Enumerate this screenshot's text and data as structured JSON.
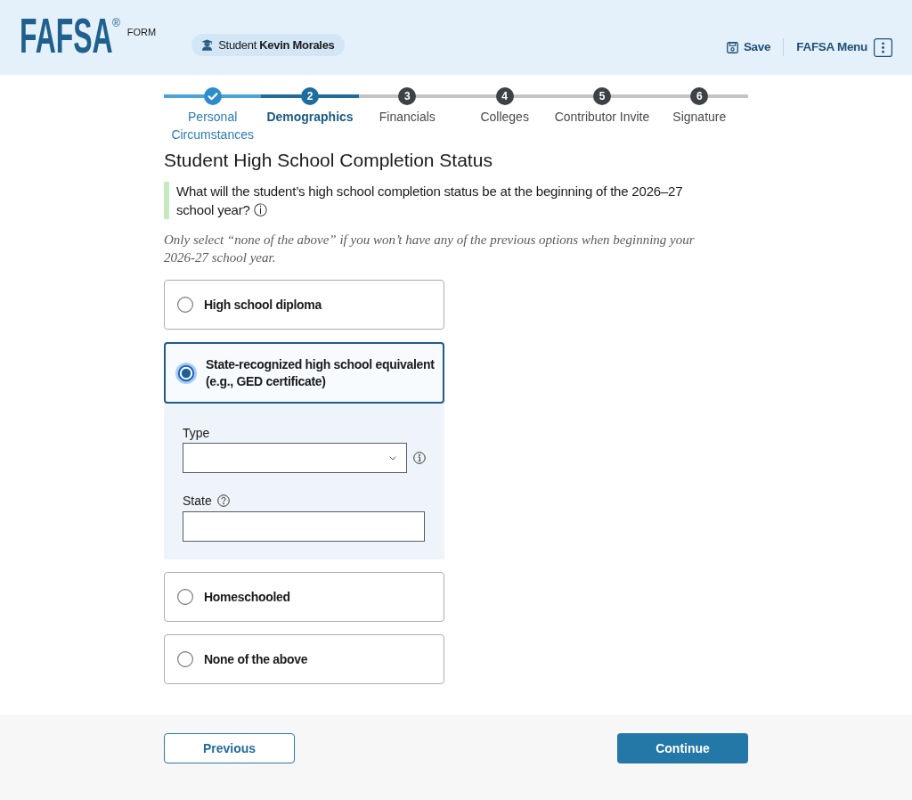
{
  "header": {
    "logo": "FAFSA",
    "logo_mark": "®",
    "logo_suffix": "FORM",
    "user_badge": "Student **Kevin Morales**",
    "actions": [
      {
        "kind": "save",
        "label": "Save"
      },
      {
        "kind": "menu",
        "label": "FAFSA Menu"
      }
    ]
  },
  "stepper": [
    {
      "label": "Personal Circumstances",
      "completed": true,
      "selected": false
    },
    {
      "number": "2",
      "label": "Demographics",
      "completed": false,
      "selected": true
    },
    {
      "number": "3",
      "label": "Financials",
      "completed": false,
      "selected": false
    },
    {
      "number": "4",
      "label": "Colleges",
      "completed": false,
      "selected": false
    },
    {
      "number": "5",
      "label": "Contributor Invite",
      "completed": false,
      "selected": false
    },
    {
      "number": "6",
      "label": "Signature",
      "completed": false,
      "selected": false
    }
  ],
  "question": {
    "title": "Student High School Completion Status",
    "prompt": "What will the student’s high school completion status be at the beginning of the 2026–27 school year? ⓘ",
    "hint": "Only select “none of the above” if you won’t have any of the previous options when beginning your 2026-27 school year.",
    "options": [
      {
        "label": "High school diploma",
        "selected": false
      },
      {
        "label": "State-recognized high school equivalent (e.g., GED certificate)",
        "selected": true,
        "fields": [
          {
            "kind": "select",
            "label": "Type"
          },
          {
            "kind": "text",
            "label": "State"
          }
        ]
      },
      {
        "label": "Homeschooled",
        "selected": false
      },
      {
        "label": "None of the above",
        "selected": false
      }
    ]
  },
  "footer": {
    "previous": "Previous",
    "continue": "Continue"
  }
}
